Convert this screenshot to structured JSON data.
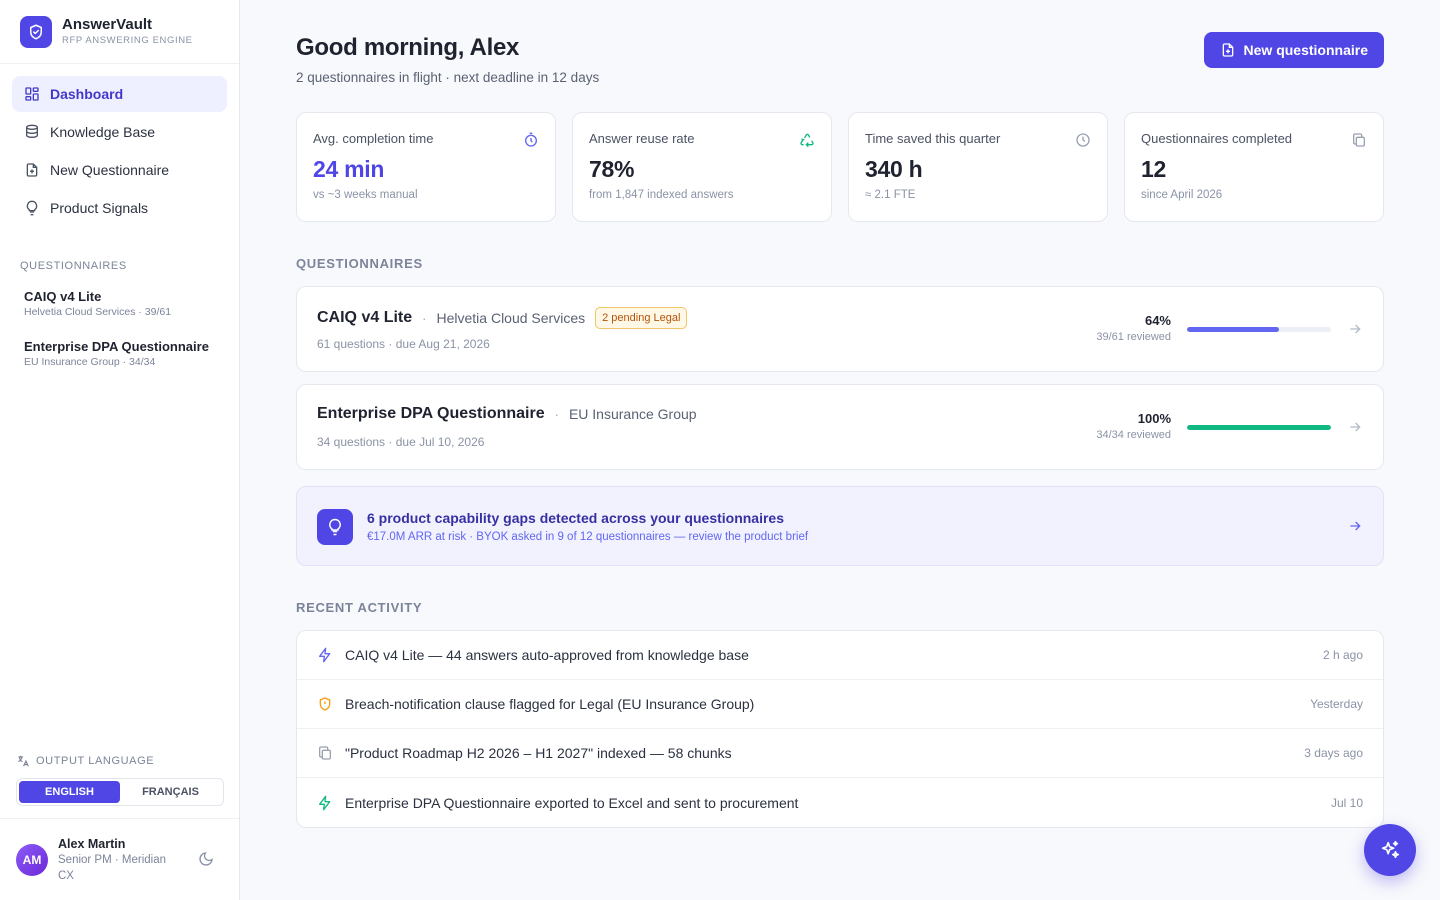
{
  "brand": {
    "name": "AnswerVault",
    "tagline": "RFP ANSWERING ENGINE"
  },
  "nav": [
    {
      "label": "Dashboard",
      "icon": "dashboard-icon",
      "active": true
    },
    {
      "label": "Knowledge Base",
      "icon": "database-icon"
    },
    {
      "label": "New Questionnaire",
      "icon": "file-plus-icon"
    },
    {
      "label": "Product Signals",
      "icon": "lightbulb-icon"
    }
  ],
  "sidebar_questionnaires": {
    "title": "QUESTIONNAIRES",
    "items": [
      {
        "title": "CAIQ v4 Lite",
        "meta": "Helvetia Cloud Services · 39/61"
      },
      {
        "title": "Enterprise DPA Questionnaire",
        "meta": "EU Insurance Group · 34/34"
      }
    ]
  },
  "output_language": {
    "title": "OUTPUT LANGUAGE",
    "options": [
      "ENGLISH",
      "FRANÇAIS"
    ],
    "selected": "ENGLISH"
  },
  "user": {
    "initials": "AM",
    "name": "Alex Martin",
    "role": "Senior PM · Meridian CX"
  },
  "header": {
    "greeting": "Good morning, Alex",
    "subtitle": "2 questionnaires in flight · next deadline in 12 days",
    "primary_button": "New questionnaire"
  },
  "stats": [
    {
      "label": "Avg. completion time",
      "value": "24 min",
      "note": "vs ~3 weeks manual",
      "icon": "stopwatch-icon"
    },
    {
      "label": "Answer reuse rate",
      "value": "78%",
      "note": "from 1,847 indexed answers",
      "icon": "recycle-icon"
    },
    {
      "label": "Time saved this quarter",
      "value": "340 h",
      "note": "≈ 2.1 FTE",
      "icon": "clock-icon"
    },
    {
      "label": "Questionnaires completed",
      "value": "12",
      "note": "since April 2026",
      "icon": "copy-icon"
    }
  ],
  "questionnaires_section": {
    "title": "QUESTIONNAIRES",
    "items": [
      {
        "title": "CAIQ v4 Lite",
        "client": "Helvetia Cloud Services",
        "badge": "2 pending Legal",
        "meta": "61 questions · due Aug 21, 2026",
        "percent_label": "64%",
        "progress": 0.64,
        "reviewed": "39/61 reviewed",
        "bar_color": "#6366f1"
      },
      {
        "title": "Enterprise DPA Questionnaire",
        "client": "EU Insurance Group",
        "badge": "",
        "meta": "34 questions · due Jul 10, 2026",
        "percent_label": "100%",
        "progress": 1.0,
        "reviewed": "34/34 reviewed",
        "bar_color": "#10b981"
      }
    ]
  },
  "gap_banner": {
    "title": "6 product capability gaps detected across your questionnaires",
    "subtitle": "€17.0M ARR at risk · BYOK asked in 9 of 12 questionnaires — review the product brief"
  },
  "activity": {
    "title": "RECENT ACTIVITY",
    "items": [
      {
        "text": "CAIQ v4 Lite — 44 answers auto-approved from knowledge base",
        "time": "2 h ago",
        "icon": "bolt-icon",
        "color": "#6366f1"
      },
      {
        "text": "Breach-notification clause flagged for Legal (EU Insurance Group)",
        "time": "Yesterday",
        "icon": "shield-alert-icon",
        "color": "#f59e0b"
      },
      {
        "text": "\"Product Roadmap H2 2026 – H1 2027\" indexed — 58 chunks",
        "time": "3 days ago",
        "icon": "copy-icon",
        "color": "#9aa1b1"
      },
      {
        "text": "Enterprise DPA Questionnaire exported to Excel and sent to procurement",
        "time": "Jul 10",
        "icon": "bolt-icon",
        "color": "#10b981"
      }
    ]
  },
  "colors": {
    "accent": "#4f46e5",
    "success": "#10b981",
    "warning": "#f59e0b"
  }
}
